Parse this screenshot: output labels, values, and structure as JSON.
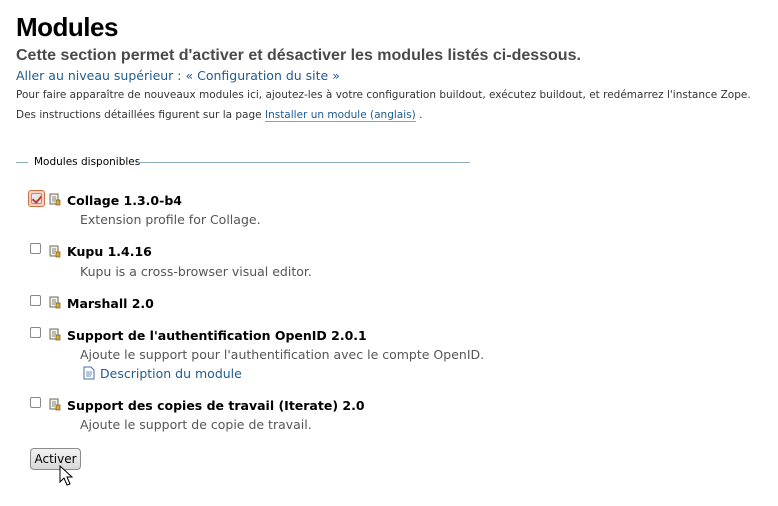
{
  "page": {
    "title": "Modules",
    "description": "Cette section permet d'activer et désactiver les modules listés ci-dessous.",
    "up_link": "Aller au niveau supérieur : « Configuration du site »",
    "help_text_1": "Pour faire apparaître de nouveaux modules ici, ajoutez-les à votre configuration buildout, exécutez buildout, et redémarrez l'instance Zope. Des instructions détaillées figurent sur la page",
    "help_link": "Installer un module (anglais)",
    "help_text_2": "."
  },
  "fieldset": {
    "legend": "Modules disponibles"
  },
  "modules": [
    {
      "title": "Collage 1.3.0-b4",
      "description": "Extension profile for Collage.",
      "checked": true
    },
    {
      "title": "Kupu 1.4.16",
      "description": "Kupu is a cross-browser visual editor.",
      "checked": false
    },
    {
      "title": "Marshall 2.0",
      "description": "",
      "checked": false
    },
    {
      "title": "Support de l'authentification OpenID 2.0.1",
      "description": "Ajoute le support pour l'authentification avec le compte OpenID.",
      "doc_link": "Description du module",
      "checked": false
    },
    {
      "title": "Support des copies de travail (Iterate) 2.0",
      "description": "Ajoute le support de copie de travail.",
      "checked": false
    }
  ],
  "submit_label": "Activer",
  "colors": {
    "link": "#205c90",
    "fieldset_line": "#8cacbb",
    "checked_mark": "#c0392b"
  },
  "icons": {
    "module": "product-icon",
    "doc": "document-icon",
    "cursor": "mouse-pointer-icon"
  }
}
